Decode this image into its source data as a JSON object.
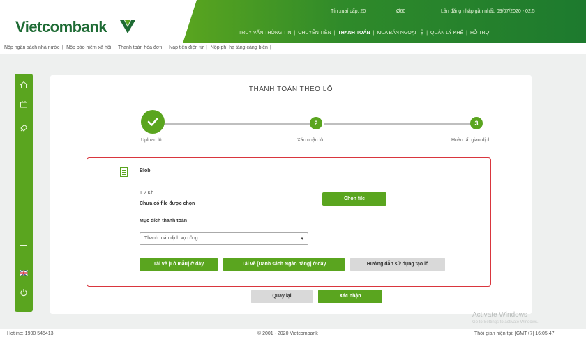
{
  "header": {
    "logo_text": "Vietcombank",
    "top_info_left": "Tín xuaí cấp: 20",
    "top_info_mid": "Ø60",
    "top_info_right": "Lần đăng nhập gần nhất: 09/07/2020 - 02:5",
    "nav": [
      "TRUY VẤN THÔNG TIN",
      "CHUYỂN TIỀN",
      "THANH TOÁN",
      "MUA BÁN NGOẠI TỆ",
      "QUẢN LÝ KHẾ",
      "HỖ TRỢ"
    ],
    "nav_active": "THANH TOÁN"
  },
  "subnav": [
    "Nộp ngân sách nhà nước",
    "Nộp bảo hiểm xã hội",
    "Thanh toán hóa đơn",
    "Nạp tiền điện tử",
    "Nộp phí hạ tầng cảng biển"
  ],
  "sidebar": {
    "icons": [
      "home-icon",
      "card-icon",
      "rocket-icon",
      "minus-icon",
      "flag-uk-icon",
      "power-icon"
    ]
  },
  "page": {
    "title": "THANH TOÁN THEO LÔ"
  },
  "stepper": {
    "steps": [
      {
        "num": "✓",
        "label": "Upload lô"
      },
      {
        "num": "2",
        "label": "Xác nhận lô"
      },
      {
        "num": "3",
        "label": "Hoàn tất giao dịch"
      }
    ]
  },
  "upload": {
    "file_label": "Blob",
    "file_size": "1.2 Kb",
    "no_file_text": "Chưa có file được chọn",
    "choose_file_btn": "Chọn file",
    "purpose_label": "Mục đích thanh toán",
    "purpose_value": "Thanh toán dịch vụ công",
    "download_sample_btn": "Tải về [Lô mẫu] ở đây",
    "download_banks_btn": "Tải về [Danh sách Ngân hàng] ở đây",
    "guide_btn": "Hướng dẫn sử dụng tạo lô"
  },
  "actions": {
    "back_btn": "Quay lại",
    "confirm_btn": "Xác nhận"
  },
  "footer": {
    "hotline": "Hotline: 1900 545413",
    "copyright": "© 2001 - 2020 Vietcombank",
    "time": "Thời gian hiện tại: [GMT+7] 16:05:47"
  },
  "watermark": {
    "line1": "Activate Windows",
    "line2": "Go to Settings to activate Windows."
  },
  "colors": {
    "brand_green": "#5aa51f",
    "dark_green": "#1e6b34",
    "highlight_red": "#d9363e"
  }
}
